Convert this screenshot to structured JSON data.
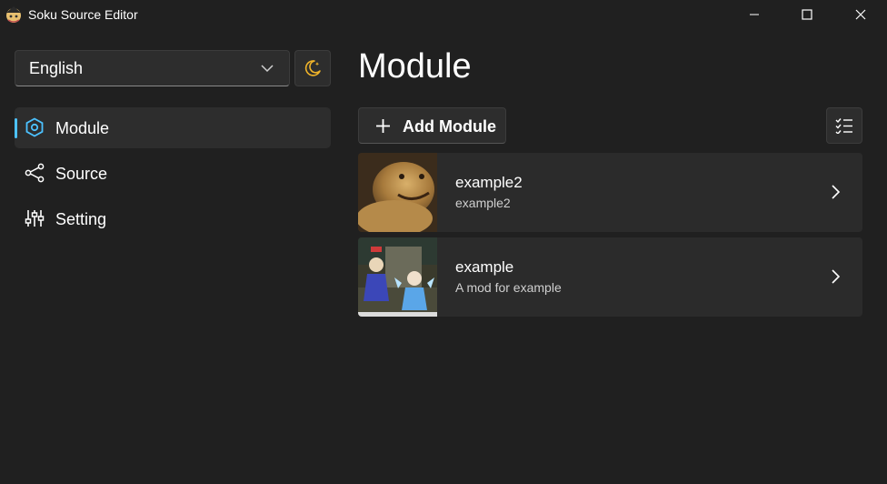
{
  "window": {
    "title": "Soku Source Editor",
    "minimize_icon": "minimize-icon",
    "maximize_icon": "maximize-icon",
    "close_icon": "close-icon"
  },
  "sidebar": {
    "language": {
      "selected": "English"
    },
    "theme_icon": "moon-icon",
    "items": [
      {
        "label": "Module",
        "icon": "module-hexagon-icon",
        "active": true
      },
      {
        "label": "Source",
        "icon": "share-nodes-icon",
        "active": false
      },
      {
        "label": "Setting",
        "icon": "sliders-icon",
        "active": false
      }
    ]
  },
  "main": {
    "title": "Module",
    "add_button": "Add Module",
    "select_icon": "checklist-icon",
    "modules": [
      {
        "name": "example2",
        "description": "example2",
        "thumbnail": "blob-creature-image"
      },
      {
        "name": "example",
        "description": "A mod for example",
        "thumbnail": "game-characters-image"
      }
    ]
  },
  "colors": {
    "background": "#202020",
    "surface": "#2d2d2d",
    "card": "#2b2b2b",
    "accent": "#4cc2ff",
    "moon": "#f0b429"
  }
}
